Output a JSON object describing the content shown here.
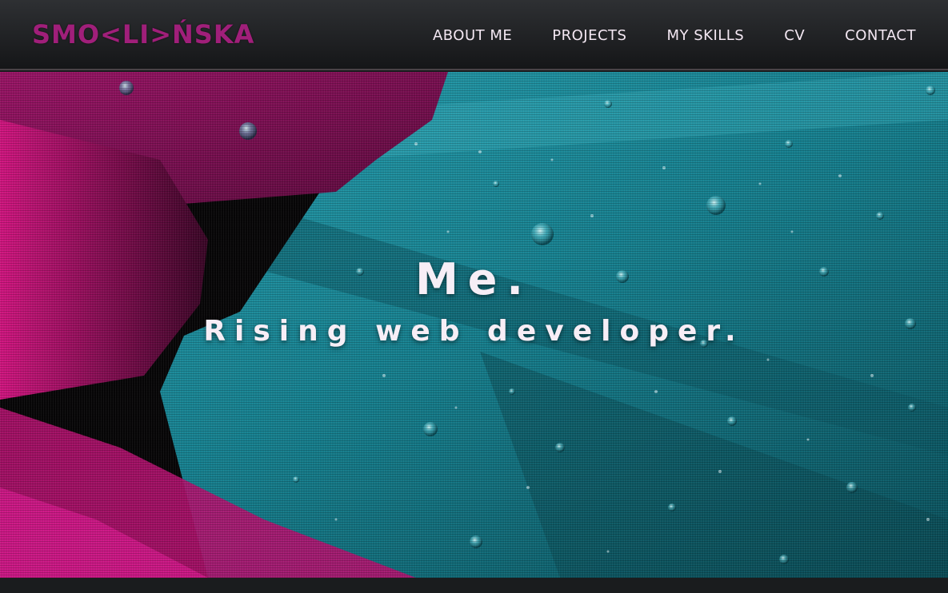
{
  "header": {
    "logo_text": "SMO<LI>ŃSKA",
    "nav": [
      {
        "label": "ABOUT ME"
      },
      {
        "label": "PROJECTS"
      },
      {
        "label": "MY SKILLS"
      },
      {
        "label": "CV"
      },
      {
        "label": "CONTACT"
      }
    ]
  },
  "hero": {
    "title": "Me.",
    "subtitle": "Rising web developer.",
    "background_image": "magenta and teal feathers with water droplets"
  },
  "colors": {
    "brand": "#a01f7a",
    "nav_text": "#f4e8f3",
    "magenta": "#b0106f",
    "teal": "#1b8a98"
  }
}
